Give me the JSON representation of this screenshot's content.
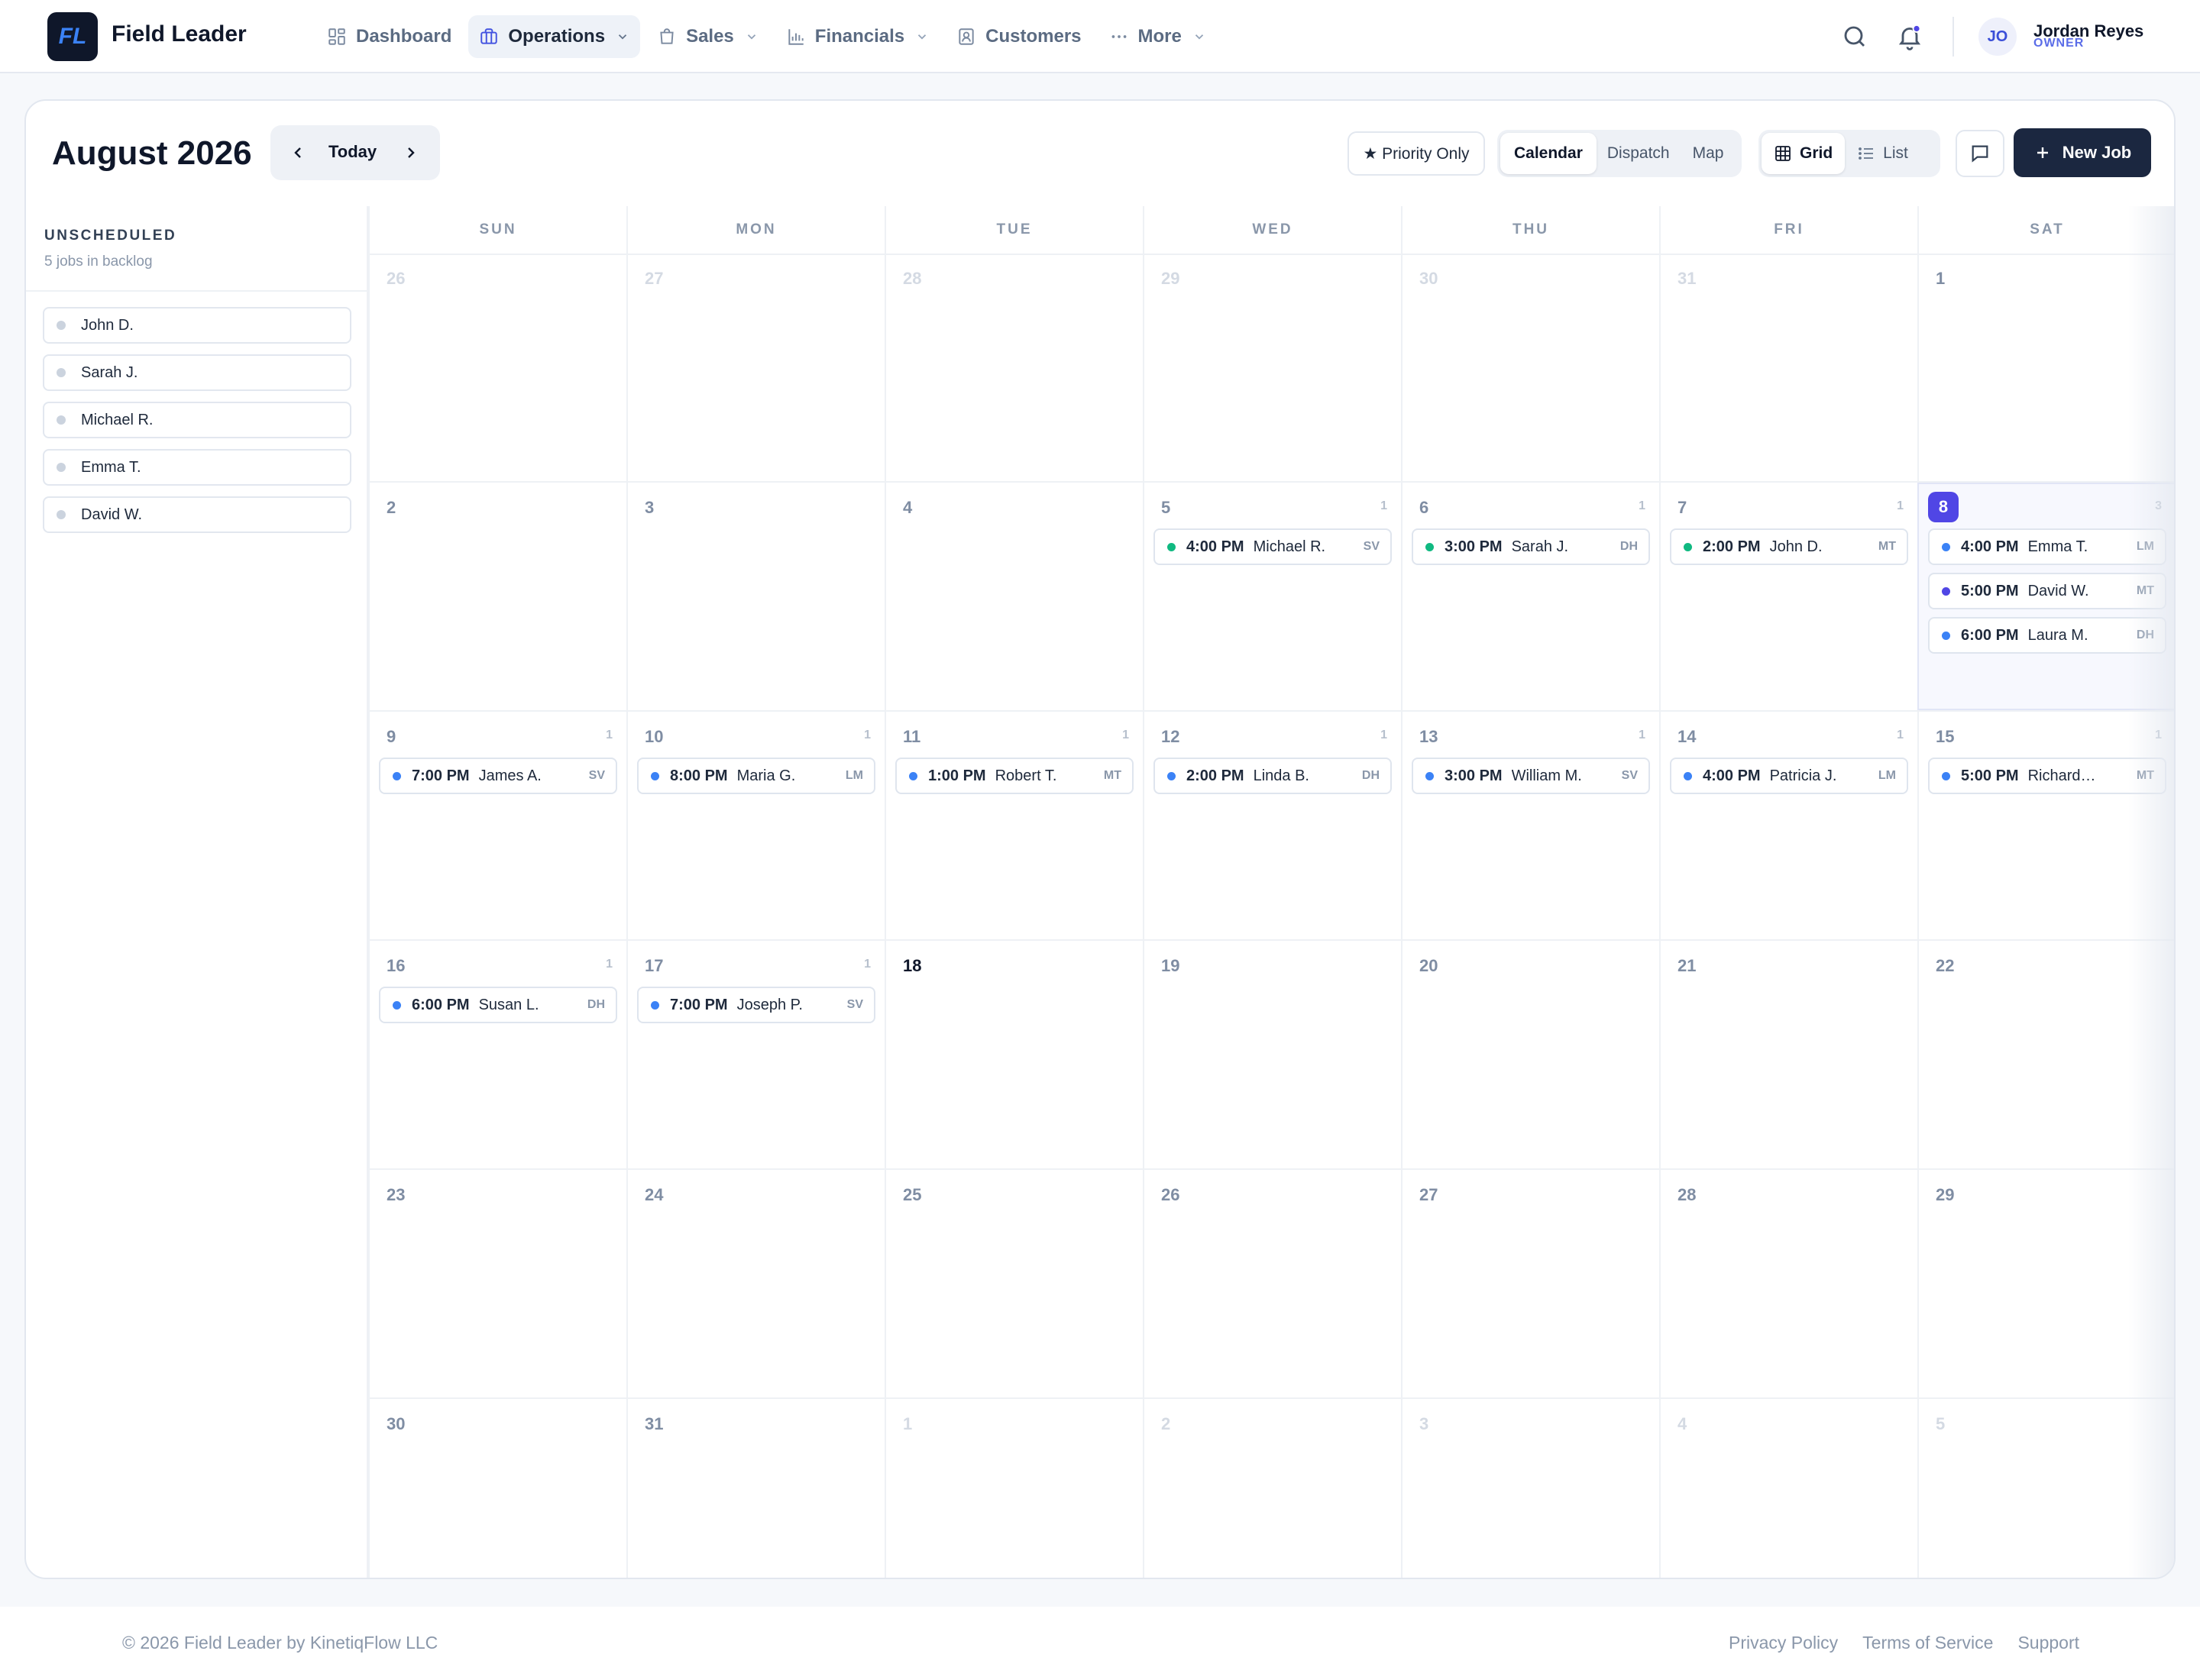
{
  "brand": {
    "logo": "FL",
    "name": "Field Leader"
  },
  "nav": {
    "items": [
      {
        "label": "Dashboard",
        "icon": "dashboard-icon",
        "active": false,
        "dropdown": false
      },
      {
        "label": "Operations",
        "icon": "briefcase-icon",
        "active": true,
        "dropdown": true
      },
      {
        "label": "Sales",
        "icon": "shopping-bag-icon",
        "active": false,
        "dropdown": true
      },
      {
        "label": "Financials",
        "icon": "bar-chart-icon",
        "active": false,
        "dropdown": true
      },
      {
        "label": "Customers",
        "icon": "contact-icon",
        "active": false,
        "dropdown": false
      },
      {
        "label": "More",
        "icon": "more-icon",
        "active": false,
        "dropdown": true
      }
    ]
  },
  "user": {
    "initials": "JO",
    "name": "Jordan Reyes",
    "role": "OWNER"
  },
  "colors": {
    "accent": "#5046e5",
    "navy": "#1b2740",
    "blue_dot": "#3b82f6",
    "green_dot": "#10b981"
  },
  "toolbar": {
    "month": "August 2026",
    "today": "Today",
    "priority": "★ Priority Only",
    "views": [
      "Calendar",
      "Dispatch",
      "Map"
    ],
    "active_view": "Calendar",
    "layouts": [
      "Grid",
      "List"
    ],
    "active_layout": "Grid",
    "new_job": "New Job"
  },
  "sidebar": {
    "title": "UNSCHEDULED",
    "subtitle": "5 jobs in backlog",
    "items": [
      "John D.",
      "Sarah J.",
      "Michael R.",
      "Emma T.",
      "David W."
    ]
  },
  "calendar": {
    "weekdays": [
      "SUN",
      "MON",
      "TUE",
      "WED",
      "THU",
      "FRI",
      "SAT"
    ],
    "weeks": [
      [
        {
          "day": "26",
          "muted": true
        },
        {
          "day": "27",
          "muted": true
        },
        {
          "day": "28",
          "muted": true
        },
        {
          "day": "29",
          "muted": true
        },
        {
          "day": "30",
          "muted": true
        },
        {
          "day": "31",
          "muted": true
        },
        {
          "day": "1"
        }
      ],
      [
        {
          "day": "2"
        },
        {
          "day": "3"
        },
        {
          "day": "4"
        },
        {
          "day": "5",
          "count": "1",
          "events": [
            {
              "time": "4:00 PM",
              "name": "Michael R.",
              "tag": "SV",
              "status": "green"
            }
          ]
        },
        {
          "day": "6",
          "count": "1",
          "events": [
            {
              "time": "3:00 PM",
              "name": "Sarah J.",
              "tag": "DH",
              "status": "green"
            }
          ]
        },
        {
          "day": "7",
          "count": "1",
          "events": [
            {
              "time": "2:00 PM",
              "name": "John D.",
              "tag": "MT",
              "status": "green"
            }
          ]
        },
        {
          "day": "8",
          "today": true,
          "count": "3",
          "events": [
            {
              "time": "4:00 PM",
              "name": "Emma T.",
              "tag": "LM",
              "status": "blue"
            },
            {
              "time": "5:00 PM",
              "name": "David W.",
              "tag": "MT",
              "status": "indigo"
            },
            {
              "time": "6:00 PM",
              "name": "Laura M.",
              "tag": "DH",
              "status": "blue"
            }
          ]
        }
      ],
      [
        {
          "day": "9",
          "count": "1",
          "events": [
            {
              "time": "7:00 PM",
              "name": "James A.",
              "tag": "SV",
              "status": "blue"
            }
          ]
        },
        {
          "day": "10",
          "count": "1",
          "events": [
            {
              "time": "8:00 PM",
              "name": "Maria G.",
              "tag": "LM",
              "status": "blue"
            }
          ]
        },
        {
          "day": "11",
          "count": "1",
          "events": [
            {
              "time": "1:00 PM",
              "name": "Robert T.",
              "tag": "MT",
              "status": "blue"
            }
          ]
        },
        {
          "day": "12",
          "count": "1",
          "events": [
            {
              "time": "2:00 PM",
              "name": "Linda B.",
              "tag": "DH",
              "status": "blue"
            }
          ]
        },
        {
          "day": "13",
          "count": "1",
          "events": [
            {
              "time": "3:00 PM",
              "name": "William M.",
              "tag": "SV",
              "status": "blue"
            }
          ]
        },
        {
          "day": "14",
          "count": "1",
          "events": [
            {
              "time": "4:00 PM",
              "name": "Patricia J.",
              "tag": "LM",
              "status": "blue"
            }
          ]
        },
        {
          "day": "15",
          "count": "1",
          "events": [
            {
              "time": "5:00 PM",
              "name": "Richard…",
              "tag": "MT",
              "status": "blue"
            }
          ]
        }
      ],
      [
        {
          "day": "16",
          "count": "1",
          "events": [
            {
              "time": "6:00 PM",
              "name": "Susan L.",
              "tag": "DH",
              "status": "blue"
            }
          ]
        },
        {
          "day": "17",
          "count": "1",
          "events": [
            {
              "time": "7:00 PM",
              "name": "Joseph P.",
              "tag": "SV",
              "status": "blue"
            }
          ]
        },
        {
          "day": "18",
          "current": true
        },
        {
          "day": "19"
        },
        {
          "day": "20"
        },
        {
          "day": "21"
        },
        {
          "day": "22"
        }
      ],
      [
        {
          "day": "23"
        },
        {
          "day": "24"
        },
        {
          "day": "25"
        },
        {
          "day": "26"
        },
        {
          "day": "27"
        },
        {
          "day": "28"
        },
        {
          "day": "29"
        }
      ],
      [
        {
          "day": "30"
        },
        {
          "day": "31"
        },
        {
          "day": "1",
          "muted": true
        },
        {
          "day": "2",
          "muted": true
        },
        {
          "day": "3",
          "muted": true
        },
        {
          "day": "4",
          "muted": true
        },
        {
          "day": "5",
          "muted": true
        }
      ]
    ]
  },
  "footer": {
    "copyright": "© 2026 Field Leader by KinetiqFlow LLC",
    "links": [
      "Privacy Policy",
      "Terms of Service",
      "Support"
    ]
  }
}
